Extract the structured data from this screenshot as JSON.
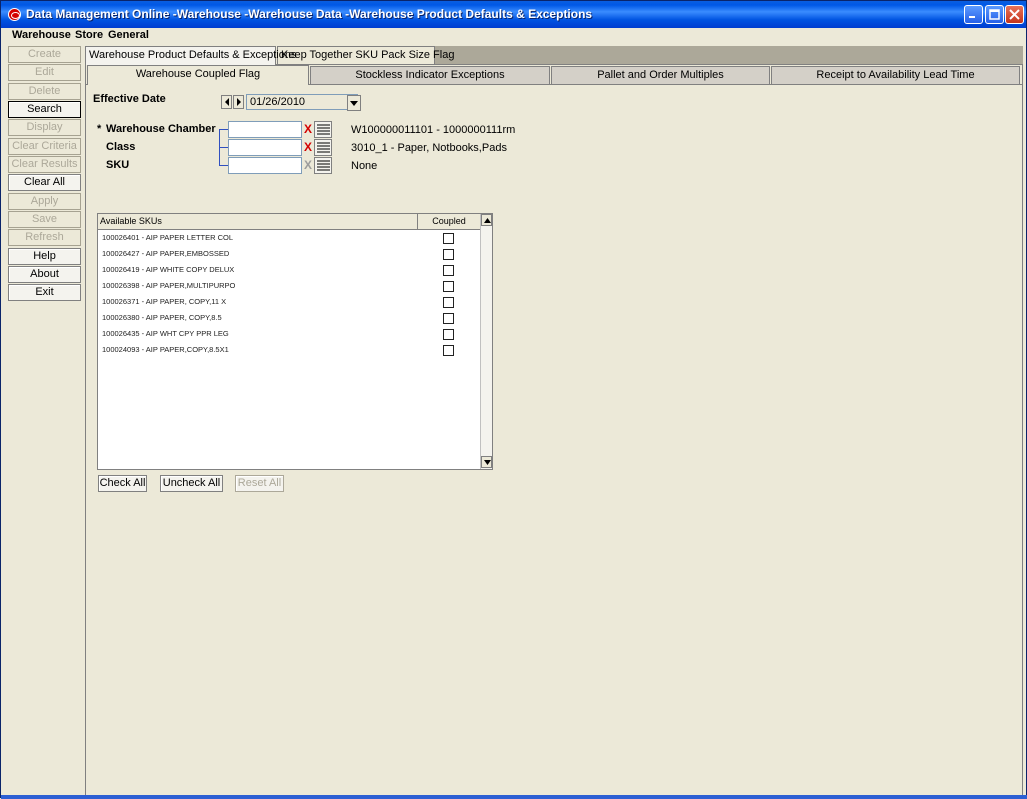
{
  "window": {
    "title": "Data Management Online -Warehouse -Warehouse Data -Warehouse Product Defaults & Exceptions"
  },
  "menu": [
    "Warehouse",
    "Store",
    "General"
  ],
  "left_buttons": [
    {
      "label": "Create",
      "enabled": false
    },
    {
      "label": "Edit",
      "enabled": false
    },
    {
      "label": "Delete",
      "enabled": false
    },
    {
      "label": "Search",
      "enabled": true
    },
    {
      "label": "Display",
      "enabled": false
    },
    {
      "label": "Clear Criteria",
      "enabled": false
    },
    {
      "label": "Clear Results",
      "enabled": false
    },
    {
      "label": "Clear All",
      "enabled": true
    },
    {
      "label": "Apply",
      "enabled": false
    },
    {
      "label": "Save",
      "enabled": false
    },
    {
      "label": "Refresh",
      "enabled": false
    },
    {
      "label": "Help",
      "enabled": true
    },
    {
      "label": "About",
      "enabled": true
    },
    {
      "label": "Exit",
      "enabled": true
    }
  ],
  "top_tabs": [
    "Warehouse Product Defaults & Exceptions",
    "Keep Together SKU Pack Size Flag"
  ],
  "sub_tabs": [
    "Warehouse Coupled Flag",
    "Stockless Indicator Exceptions",
    "Pallet and Order Multiples",
    "Receipt to Availability Lead Time"
  ],
  "form": {
    "effective_date_label": "Effective Date",
    "effective_date_value": "01/26/2010",
    "required_marker": "*",
    "warehouse_chamber_label": "Warehouse Chamber",
    "warehouse_chamber_value": "W100000011101 - 1000000111rm",
    "class_label": "Class",
    "class_value": "3010_1 - Paper, Notbooks,Pads",
    "sku_label": "SKU",
    "sku_value": "None",
    "clear_glyph": "X"
  },
  "grid": {
    "col_sku": "Available SKUs",
    "col_coupled": "Coupled",
    "rows": [
      {
        "sku": "100026401 - AIP PAPER LETTER COL",
        "coupled": false
      },
      {
        "sku": "100026427 - AIP PAPER,EMBOSSED",
        "coupled": false
      },
      {
        "sku": "100026419 - AIP WHITE COPY DELUX",
        "coupled": false
      },
      {
        "sku": "100026398 - AIP PAPER,MULTIPURPO",
        "coupled": false
      },
      {
        "sku": "100026371 - AIP PAPER, COPY,11 X",
        "coupled": false
      },
      {
        "sku": "100026380 - AIP PAPER, COPY,8.5",
        "coupled": false
      },
      {
        "sku": "100026435 - AIP WHT CPY PPR LEG",
        "coupled": false
      },
      {
        "sku": "100024093 - AIP PAPER,COPY,8.5X1",
        "coupled": false
      }
    ]
  },
  "grid_buttons": [
    {
      "label": "Check All",
      "enabled": true
    },
    {
      "label": "Uncheck All",
      "enabled": true
    },
    {
      "label": "Reset All",
      "enabled": false
    }
  ]
}
